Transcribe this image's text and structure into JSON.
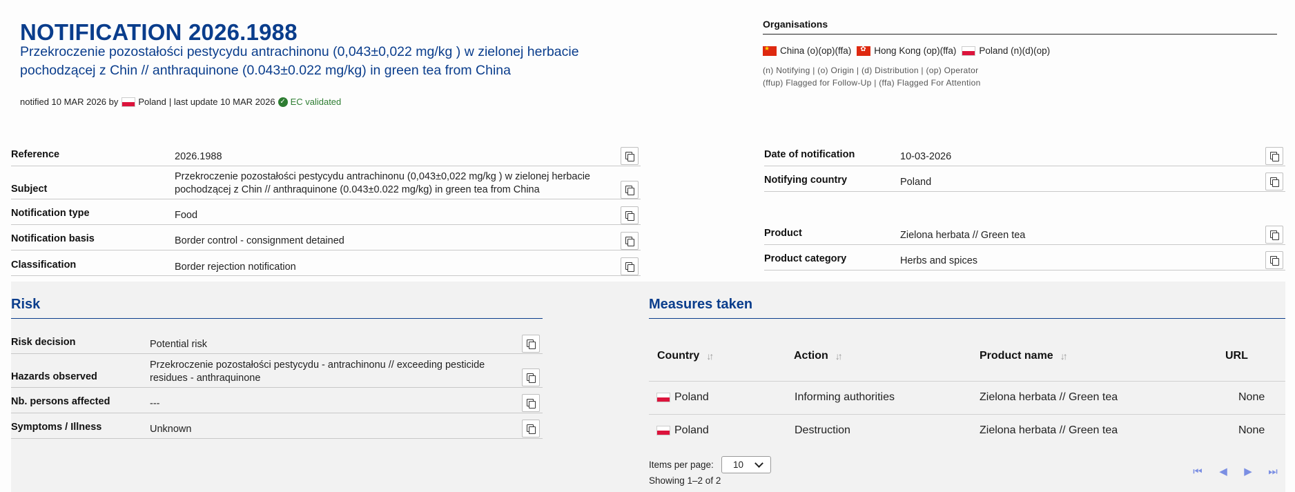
{
  "header": {
    "title": "NOTIFICATION 2026.1988",
    "subtitle": "Przekroczenie pozostałości pestycydu antrachinonu (0,043±0,022 mg/kg ) w zielonej herbacie pochodzącej z Chin // anthraquinone (0.043±0.022 mg/kg) in green tea from China",
    "notified_prefix": "notified 10 MAR 2026 by",
    "notified_country": "Poland",
    "last_update": "| last update 10 MAR 2026",
    "validated": "EC validated"
  },
  "organisations": {
    "title": "Organisations",
    "items": [
      {
        "flag": "flag-china-icon",
        "label": "China (o)(op)(ffa)"
      },
      {
        "flag": "flag-hong-kong-icon",
        "label": "Hong Kong (op)(ffa)"
      },
      {
        "flag": "flag-poland-icon",
        "label": "Poland (n)(d)(op)"
      }
    ],
    "legend_line1": "(n) Notifying | (o) Origin | (d) Distribution | (op) Operator",
    "legend_line2": "(ffup) Flagged for Follow-Up | (ffa) Flagged For Attention"
  },
  "details_left": [
    {
      "label": "Reference",
      "value": "2026.1988"
    },
    {
      "label": "Subject",
      "value": "Przekroczenie pozostałości pestycydu antrachinonu (0,043±0,022 mg/kg ) w zielonej herbacie pochodzącej z Chin // anthraquinone (0.043±0.022 mg/kg) in green tea from China"
    },
    {
      "label": "Notification type",
      "value": "Food"
    },
    {
      "label": "Notification basis",
      "value": "Border control - consignment detained"
    },
    {
      "label": "Classification",
      "value": "Border rejection notification"
    }
  ],
  "details_right": [
    {
      "label": "Date of notification",
      "value": "10-03-2026"
    },
    {
      "label": "Notifying country",
      "value": "Poland"
    },
    {
      "label": "Product",
      "value": "Zielona herbata // Green tea"
    },
    {
      "label": "Product category",
      "value": "Herbs and spices"
    }
  ],
  "risk": {
    "title": "Risk",
    "rows": [
      {
        "label": "Risk decision",
        "value": "Potential risk"
      },
      {
        "label": "Hazards observed",
        "value": "Przekroczenie pozostałości pestycydu - antrachinonu // exceeding pesticide residues - anthraquinone"
      },
      {
        "label": "Nb. persons affected",
        "value": "---"
      },
      {
        "label": "Symptoms / Illness",
        "value": "Unknown"
      }
    ]
  },
  "measures": {
    "title": "Measures taken",
    "columns": [
      "Country",
      "Action",
      "Product name",
      "URL"
    ],
    "rows": [
      {
        "country": "Poland",
        "action": "Informing authorities",
        "product": "Zielona herbata // Green tea",
        "url": "None"
      },
      {
        "country": "Poland",
        "action": "Destruction",
        "product": "Zielona herbata // Green tea",
        "url": "None"
      }
    ],
    "items_per_page_label": "Items per page:",
    "items_per_page_value": "10",
    "showing": "Showing 1–2 of 2"
  }
}
